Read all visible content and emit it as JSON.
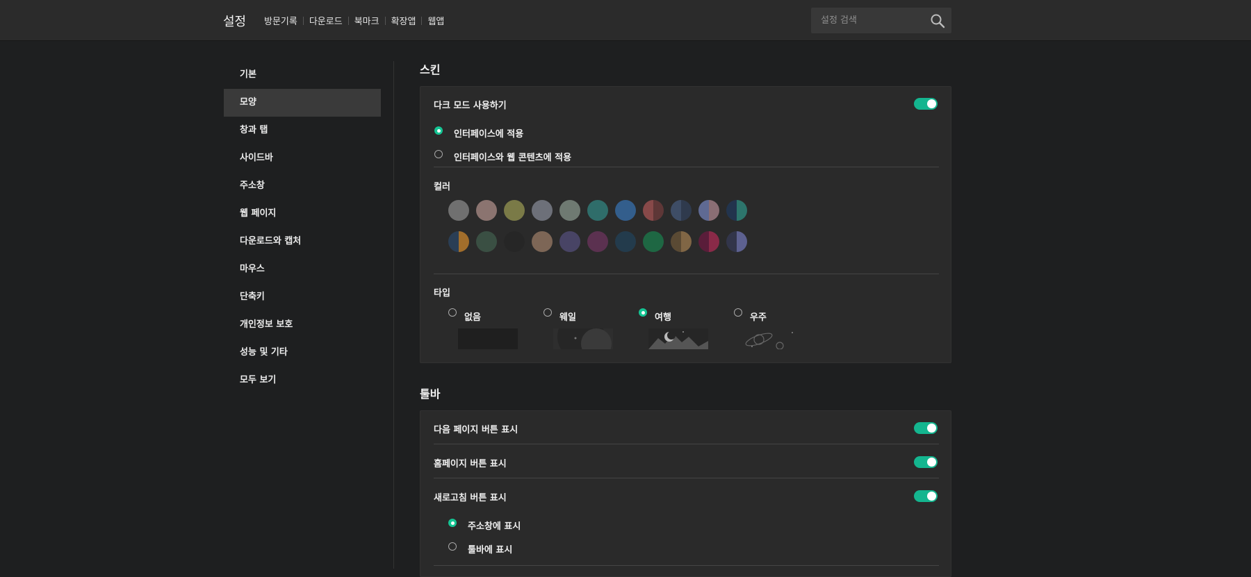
{
  "header": {
    "title": "설정",
    "nav": [
      "방문기록",
      "다운로드",
      "북마크",
      "확장앱",
      "웹앱"
    ],
    "search_placeholder": "설정 검색"
  },
  "sidebar": {
    "items": [
      "기본",
      "모양",
      "창과 탭",
      "사이드바",
      "주소창",
      "웹 페이지",
      "다운로드와 캡처",
      "마우스",
      "단축키",
      "개인정보 보호",
      "성능 및 기타",
      "모두 보기"
    ],
    "active": "모양"
  },
  "skin": {
    "title": "스킨",
    "dark_mode_label": "다크 모드 사용하기",
    "dark_mode_on": true,
    "options": [
      "인터페이스에 적용",
      "인터페이스와 웹 콘텐츠에 적용"
    ],
    "selected_option": "인터페이스에 적용",
    "color_label": "컬러",
    "color_rows": [
      [
        [
          "#707070",
          "#707070"
        ],
        [
          "#8b7470",
          "#8b7470"
        ],
        [
          "#7a7a47",
          "#7a7a47"
        ],
        [
          "#6d7079",
          "#6d7079"
        ],
        [
          "#6f7a72",
          "#6f7a72"
        ],
        [
          "#2f6d6a",
          "#2f6d6a"
        ],
        [
          "#335e8c",
          "#335e8c"
        ],
        [
          "#874949",
          "#5e3737"
        ],
        [
          "#3e4d66",
          "#2f3a4d"
        ],
        [
          "#5f6a93",
          "#8a6e74"
        ],
        [
          "#22344d",
          "#2d756c"
        ]
      ],
      [
        [
          "#2a3e55",
          "#a26e2b"
        ],
        [
          "#3a4f43",
          "#3a4f43"
        ],
        [
          "#262626",
          "#262626"
        ],
        [
          "#7d6656",
          "#7d6656"
        ],
        [
          "#484465",
          "#484465"
        ],
        [
          "#5b3150",
          "#5b3150"
        ],
        [
          "#233b4c",
          "#233b4c"
        ],
        [
          "#1e6743",
          "#1e6743"
        ],
        [
          "#5a4a34",
          "#806645"
        ],
        [
          "#5a1d3a",
          "#8a2a48"
        ],
        [
          "#32354a",
          "#5d6190"
        ]
      ]
    ],
    "type_label": "타입",
    "types": [
      "없음",
      "웨일",
      "여행",
      "우주"
    ],
    "selected_type": "여행"
  },
  "toolbar": {
    "title": "툴바",
    "rows": [
      {
        "label": "다음 페이지 버튼 표시",
        "on": true
      },
      {
        "label": "홈페이지 버튼 표시",
        "on": true
      },
      {
        "label": "새로고침 버튼 표시",
        "on": true
      }
    ],
    "refresh_options": [
      "주소창에 표시",
      "툴바에 표시"
    ],
    "selected_refresh": "주소창에 표시"
  }
}
